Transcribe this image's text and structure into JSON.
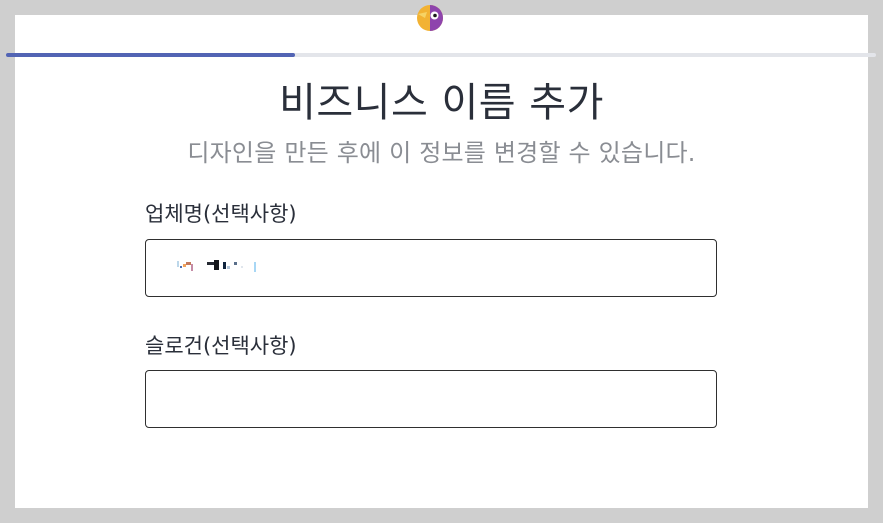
{
  "header": {
    "logo_icon": "toucan-logo-icon",
    "progress_fraction": 0.33,
    "colors": {
      "progress_fill": "#5264b4",
      "progress_track": "#e3e5ea"
    }
  },
  "main": {
    "title": "비즈니스 이름 추가",
    "subtitle": "디자인을 만든 후에 이 정보를 변경할 수 있습니다.",
    "fields": [
      {
        "label": "업체명(선택사항)",
        "value": "",
        "placeholder": ""
      },
      {
        "label": "슬로건(선택사항)",
        "value": "",
        "placeholder": ""
      }
    ]
  }
}
